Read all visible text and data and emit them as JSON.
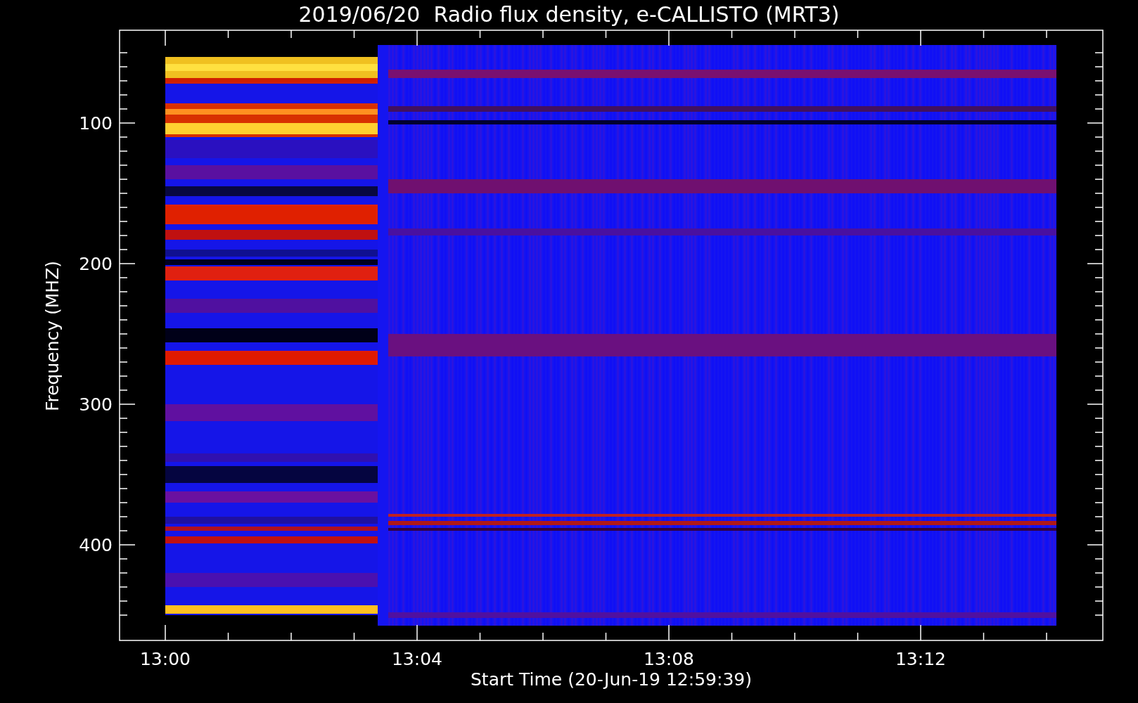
{
  "title": "2019/06/20  Radio flux density, e-CALLISTO (MRT3)",
  "y_axis": {
    "label": "Frequency (MHZ)",
    "ticks": [
      "100",
      "200",
      "300",
      "400"
    ]
  },
  "x_axis": {
    "label": "Start Time (20-Jun-19 12:59:39)",
    "ticks": [
      "13:00",
      "13:04",
      "13:08",
      "13:12"
    ]
  }
}
